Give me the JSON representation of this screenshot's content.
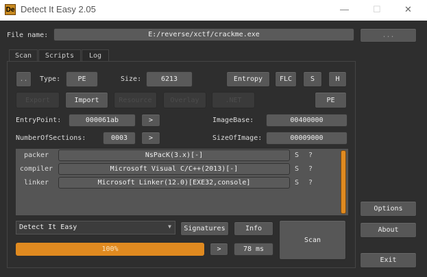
{
  "window": {
    "title": "Detect It Easy 2.05",
    "logo": "De",
    "min": "—",
    "max": "☐",
    "close": "✕"
  },
  "file": {
    "label": "File name:",
    "value": "E:/reverse/xctf/crackme.exe",
    "browse": "..."
  },
  "tabs": [
    "Scan",
    "Scripts",
    "Log"
  ],
  "scan": {
    "dots": "..",
    "type_label": "Type:",
    "type": "PE",
    "size_label": "Size:",
    "size": "6213",
    "entropy": "Entropy",
    "flc": "FLC",
    "s": "S",
    "h": "H",
    "export": "Export",
    "import": "Import",
    "resource": "Resource",
    "overlay": "Overlay",
    "net": ".NET",
    "pe": "PE",
    "entry_label": "EntryPoint:",
    "entry": "000061ab",
    "imagebase_label": "ImageBase:",
    "imagebase": "00400000",
    "sections_label": "NumberOfSections:",
    "sections": "0003",
    "sizeofimage_label": "SizeOfImage:",
    "sizeofimage": "00009000",
    "arrow": ">",
    "results": [
      {
        "type": "packer",
        "name": "NsPacK(3.x)[-]",
        "s": "S",
        "q": "?"
      },
      {
        "type": "compiler",
        "name": "Microsoft Visual C/C++(2013)[-]",
        "s": "S",
        "q": "?"
      },
      {
        "type": "linker",
        "name": "Microsoft Linker(12.0)[EXE32,console]",
        "s": "S",
        "q": "?"
      }
    ],
    "engine": "Detect It Easy",
    "signatures": "Signatures",
    "info": "Info",
    "scan": "Scan",
    "progress_text": "100%",
    "progress": 100,
    "time": "78 ms"
  },
  "side": {
    "options": "Options",
    "about": "About",
    "exit": "Exit"
  },
  "colors": {
    "accent": "#e08a20"
  }
}
